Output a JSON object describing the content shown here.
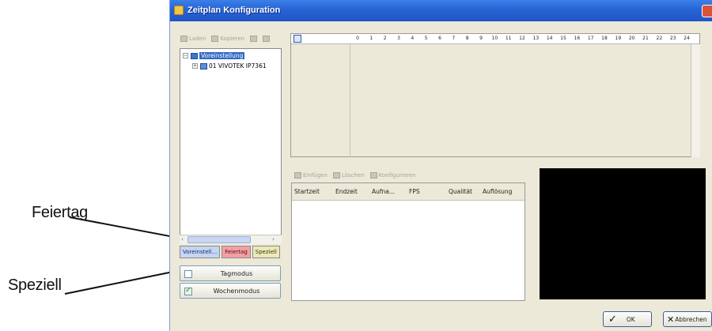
{
  "window": {
    "title": "Zeitplan Konfiguration"
  },
  "tree_toolbar": {
    "load": "Laden",
    "copy": "Kopieren"
  },
  "tree": {
    "root": {
      "expander": "−",
      "label": "Voreinstellung"
    },
    "child": {
      "expander": "+",
      "label": "01 VIVOTEK IP7361"
    }
  },
  "tabs": [
    "Voreinstell...",
    "Feiertag",
    "Speziell"
  ],
  "modes": {
    "day": "Tagmodus",
    "week": "Wochenmodus"
  },
  "schedule": {
    "hours": [
      "0",
      "1",
      "2",
      "3",
      "4",
      "5",
      "6",
      "7",
      "8",
      "9",
      "10",
      "11",
      "12",
      "13",
      "14",
      "15",
      "16",
      "17",
      "18",
      "19",
      "20",
      "21",
      "22",
      "23",
      "24"
    ]
  },
  "action_toolbar": {
    "insert": "Einfügen",
    "delete": "Löschen",
    "configure": "Konfigurieren"
  },
  "list": {
    "columns": [
      "Startzeit",
      "Endzeit",
      "Aufna...",
      "FPS",
      "Qualität",
      "Auflösung"
    ]
  },
  "footer": {
    "ok": "OK",
    "cancel": "Abbrechen"
  },
  "callouts": {
    "holiday": "Feiertag",
    "special": "Speziell"
  }
}
